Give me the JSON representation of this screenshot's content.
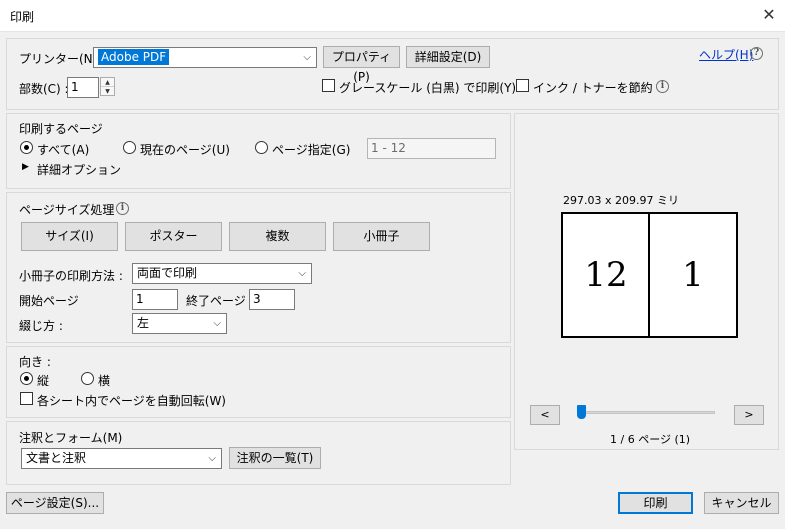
{
  "window": {
    "title": "印刷",
    "close_icon": "close-icon"
  },
  "printer": {
    "label": "プリンター(N) :",
    "selected": "Adobe PDF",
    "properties_button": "プロパティ(P)",
    "advanced_button": "詳細設定(D)",
    "help_link": "ヘルプ(H)",
    "copies_label": "部数(C) :",
    "copies_value": "1",
    "grayscale_label": "グレースケール (白黒) で印刷(Y)",
    "grayscale_checked": false,
    "save_ink_label": "インク / トナーを節約",
    "save_ink_checked": false
  },
  "pages_to_print": {
    "title": "印刷するページ",
    "options": [
      {
        "label": "すべて(A)",
        "selected": true
      },
      {
        "label": "現在のページ(U)",
        "selected": false
      },
      {
        "label": "ページ指定(G)",
        "selected": false
      }
    ],
    "range_value": "1 - 12",
    "more_options": "詳細オプション"
  },
  "page_sizing": {
    "title": "ページサイズ処理",
    "tabs": [
      "サイズ(I)",
      "ポスター",
      "複数",
      "小冊子"
    ],
    "booklet_method_label": "小冊子の印刷方法 :",
    "booklet_method_value": "両面で印刷",
    "start_page_label": "開始ページ",
    "start_page_value": "1",
    "end_page_label": "終了ページ",
    "end_page_value": "3",
    "binding_label": "綴じ方 :",
    "binding_value": "左"
  },
  "orientation": {
    "title": "向き :",
    "options": [
      {
        "label": "縦",
        "selected": true
      },
      {
        "label": "横",
        "selected": false
      }
    ],
    "auto_rotate_label": "各シート内でページを自動回転(W)",
    "auto_rotate_checked": false
  },
  "comments": {
    "title": "注釈とフォーム(M)",
    "selected": "文書と注釈",
    "summary_button": "注釈の一覧(T)"
  },
  "preview": {
    "dimensions": "297.03 x 209.97 ミリ",
    "left_page": "12",
    "right_page": "1",
    "prev_button": "<",
    "next_button": ">",
    "page_indicator": "1 / 6 ページ (1)",
    "slider_position": 0
  },
  "footer": {
    "page_setup_button": "ページ設定(S)...",
    "print_button": "印刷",
    "cancel_button": "キャンセル"
  }
}
